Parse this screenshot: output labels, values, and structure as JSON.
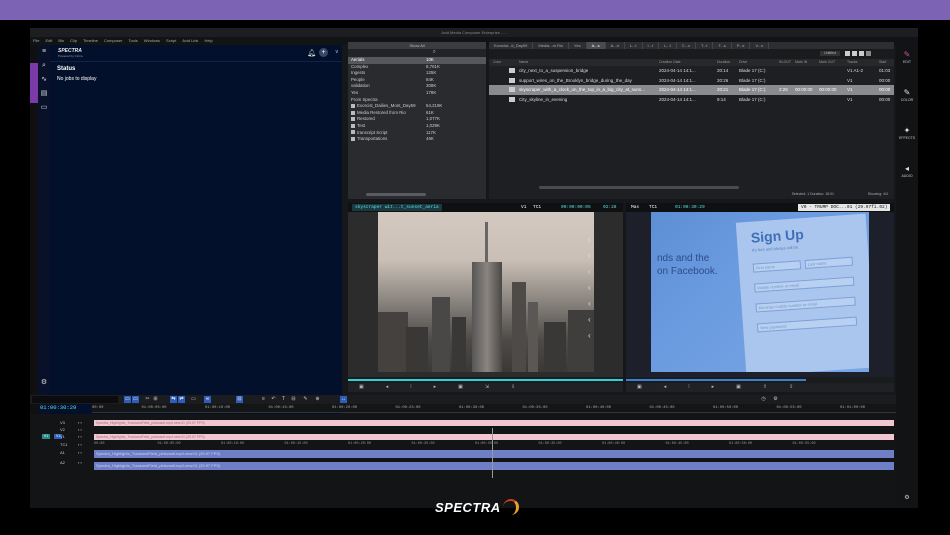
{
  "window": {
    "title": "Avid Media Composer Enterprise - ...",
    "menu": [
      "File",
      "Edit",
      "Bin",
      "Clip",
      "Timeline",
      "Composer",
      "Tools",
      "Windows",
      "Script",
      "Avid Link",
      "Help"
    ]
  },
  "spectra": {
    "brand": "SPECTRA",
    "powered": "Powered by Cintra",
    "status_title": "Status",
    "empty_message": "No jobs to display",
    "plus": "+",
    "chevron": "v"
  },
  "bin_list": {
    "tab": "Show All",
    "rows": [
      {
        "name": "Aerials",
        "count": "10K",
        "selected": true
      },
      {
        "name": "Complex",
        "count": "8,761K"
      },
      {
        "name": "Ingests",
        "count": "125K"
      },
      {
        "name": "People",
        "count": "84K"
      },
      {
        "name": "validation",
        "count": "308K"
      },
      {
        "name": "Yes",
        "count": "178K"
      },
      {
        "name": "From Spectra",
        "count": ""
      },
      {
        "name": "Exorcist_Dailies_Mont_Day59",
        "count": "54,219K",
        "icon": true
      },
      {
        "name": "Media Restored from Rio",
        "count": "61K",
        "icon": true
      },
      {
        "name": "Restored",
        "count": "1,077K",
        "icon": true
      },
      {
        "name": "Test",
        "count": "1,029K",
        "icon": true
      },
      {
        "name": "transcript Script",
        "count": "117K",
        "icon": true
      },
      {
        "name": "Transportations",
        "count": "46K",
        "icon": true
      }
    ]
  },
  "bin_tabs": [
    "Exorcist...it_Day59",
    "Media...m Rio",
    "Yes",
    "A...s",
    "A...d",
    "L...t",
    "I...t",
    "L...t",
    "C...x",
    "T...t",
    "T...s",
    "P...e",
    "V...n"
  ],
  "bin_view": {
    "dropdown": "Untitled",
    "columns": [
      "Color",
      "Name",
      "Creation Date",
      "Duration",
      "Drive",
      "IN-OUT",
      "Mark IN",
      "Mark OUT",
      "Tracks",
      "Start"
    ],
    "clips": [
      {
        "name": "city_next_to_a_suspension_bridge",
        "date": "2024-04-14 14:1...",
        "duration": "20:14",
        "drive": "Blade 17 (C:)",
        "tracks": "V1 A1-2",
        "start": "01:03",
        "selected": false
      },
      {
        "name": "support_wires_on_the_Brooklyn_bridge_during_the_day",
        "date": "2024-04-14 14:1...",
        "duration": "20:26",
        "drive": "Blade 17 (C:)",
        "tracks": "V1",
        "start": "00:00",
        "selected": false
      },
      {
        "name": "skyscraper_with_a_clock_on_the_top_in_a_big_city_at_suns...",
        "date": "2024-04-14 14:1...",
        "duration": "20:21",
        "drive": "Blade 17 (C:)",
        "inout": "2:28",
        "mark_in": "00:00:00",
        "mark_out": "00:00:00",
        "tracks": "V1",
        "start": "00:00",
        "selected": true
      },
      {
        "name": "City_skyline_in_evening",
        "date": "2024-04-14 14:1...",
        "duration": "9:14",
        "drive": "Blade 17 (C:)",
        "tracks": "V1",
        "start": "00:00",
        "selected": false
      }
    ],
    "status_selected": "Selected: 1  Duration: 18:01",
    "status_showing": "Showing: 4/4"
  },
  "source_monitor": {
    "clip": "skyscraper wit...t_sunset_aeria",
    "track": "V1",
    "tc_label": "TC1",
    "timecode": "00:00:00:05",
    "duration": "02:28"
  },
  "record_monitor": {
    "label": "Mas",
    "tc_label": "TC1",
    "timecode": "01:00:30:29",
    "sequence": "V0 - TRUMP DOC...01 (29.97fi.02)",
    "form_title": "Sign Up",
    "form_sub": "It's free and always will be.",
    "fields": [
      "First name",
      "Last name",
      "Mobile number or email",
      "Re-enter mobile number or email",
      "New password"
    ],
    "side_text": [
      "nds and the",
      "on Facebook."
    ]
  },
  "palette": [
    {
      "label": "EDIT",
      "glyph": "✎",
      "pink": true
    },
    {
      "label": "COLOR",
      "glyph": "✎"
    },
    {
      "label": "EFFECTS",
      "glyph": "✦"
    },
    {
      "label": "AUDIO",
      "glyph": "◂"
    }
  ],
  "timeline": {
    "timecode": "01:00:30:29",
    "ruler": [
      "00:00",
      "01:00:05:00",
      "01:00:10:00",
      "01:00:15:00",
      "01:00:20:00",
      "01:00:25:00",
      "01:00:30:00",
      "01:00:35:00",
      "01:00:40:00",
      "01:00:45:00",
      "01:00:50:00",
      "01:00:55:00",
      "01:01:00:00"
    ],
    "tracks": [
      {
        "name": "V3",
        "kind": "video",
        "clip": "Spectra_Highlights_TrackandField_pinkvault.mp4.new.01 (29.97 FPS)"
      },
      {
        "name": "V2",
        "kind": "video",
        "clip": ""
      },
      {
        "name": "V1",
        "kind": "video",
        "clip": "Spectra_Highlights_TrackandField_pinkvault.mp4.new.01 (29.97 FPS)"
      },
      {
        "name": "TC1",
        "kind": "tc",
        "clip": ""
      },
      {
        "name": "A1",
        "kind": "audio",
        "clip": "Spectra_Highlights_TrackandField_pinkvault.mp4.new.01 (29.97 FPS)"
      },
      {
        "name": "A2",
        "kind": "audio",
        "clip": "Spectra_Highlights_TrackandField_pinkvault.mp4.new.01 (29.97 FPS)"
      }
    ],
    "tc_marks": [
      "00:00",
      "01:00:05:00",
      "01:00:10:00",
      "01:00:15:00",
      "01:00:20:00",
      "01:00:25:00",
      "01:00:30:00",
      "01:00:35:00",
      "01:00:40:00",
      "01:00:45:00",
      "01:00:50:00",
      "01:00:55:00"
    ]
  },
  "footer_brand": "SPECTRA"
}
